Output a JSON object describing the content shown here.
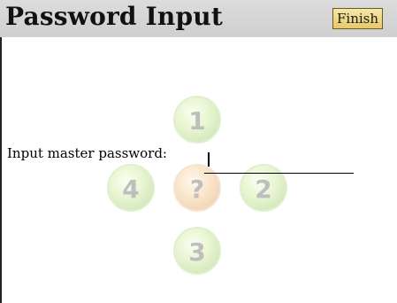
{
  "title_bar": {
    "title": "Password Input",
    "finish_label": "Finish"
  },
  "form": {
    "prompt": "Input master password:",
    "password_value": ""
  },
  "keypad": {
    "keys": [
      {
        "label": "1",
        "color": "green"
      },
      {
        "label": "4",
        "color": "green"
      },
      {
        "label": "?",
        "color": "orange"
      },
      {
        "label": "2",
        "color": "green"
      },
      {
        "label": "3",
        "color": "green"
      }
    ]
  },
  "colors": {
    "title_bar_bg": "#d6d6d6",
    "finish_button_bg": "#f0d98a",
    "key_green": "#b4d98a",
    "key_orange": "#eab07a"
  }
}
